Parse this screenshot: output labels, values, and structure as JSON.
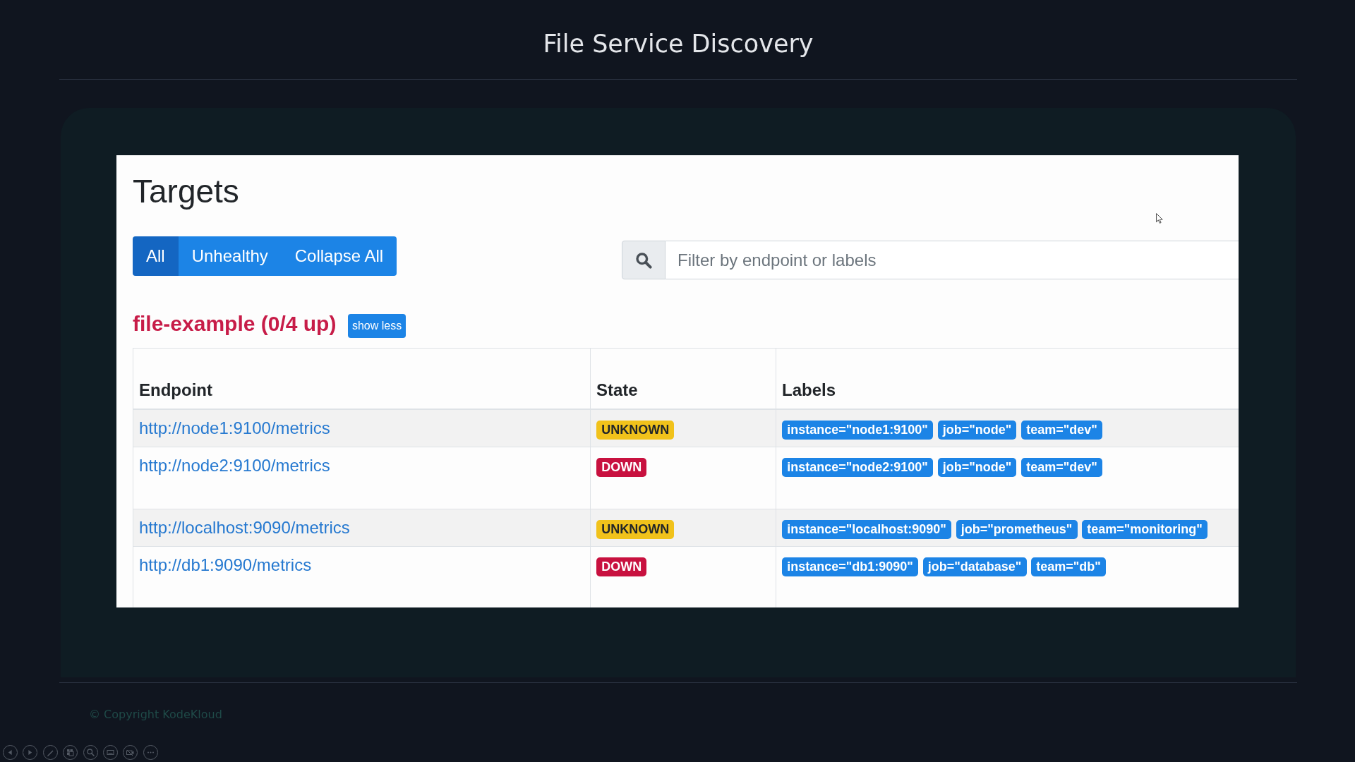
{
  "slide": {
    "title": "File Service Discovery"
  },
  "page": {
    "heading": "Targets",
    "buttons": [
      {
        "label": "All",
        "selected": true
      },
      {
        "label": "Unhealthy",
        "selected": false
      },
      {
        "label": "Collapse All",
        "selected": false
      }
    ],
    "search": {
      "placeholder": "Filter by endpoint or labels"
    },
    "pool": {
      "title": "file-example (0/4 up)",
      "healthy": false,
      "toggle": "show less"
    },
    "table": {
      "columns": [
        "Endpoint",
        "State",
        "Labels"
      ],
      "rows": [
        {
          "endpoint": "http://node1:9100/metrics",
          "state": {
            "label": "UNKNOWN",
            "kind": "unknown"
          },
          "labels": [
            "instance=\"node1:9100\"",
            "job=\"node\"",
            "team=\"dev\""
          ]
        },
        {
          "endpoint": "http://node2:9100/metrics",
          "state": {
            "label": "DOWN",
            "kind": "down"
          },
          "labels": [
            "instance=\"node2:9100\"",
            "job=\"node\"",
            "team=\"dev\""
          ]
        },
        {
          "endpoint": "http://localhost:9090/metrics",
          "state": {
            "label": "UNKNOWN",
            "kind": "unknown"
          },
          "labels": [
            "instance=\"localhost:9090\"",
            "job=\"prometheus\"",
            "team=\"monitoring\""
          ]
        },
        {
          "endpoint": "http://db1:9090/metrics",
          "state": {
            "label": "DOWN",
            "kind": "down"
          },
          "labels": [
            "instance=\"db1:9090\"",
            "job=\"database\"",
            "team=\"db\""
          ]
        }
      ]
    }
  },
  "footer": {
    "copyright": "© Copyright KodeKloud"
  }
}
